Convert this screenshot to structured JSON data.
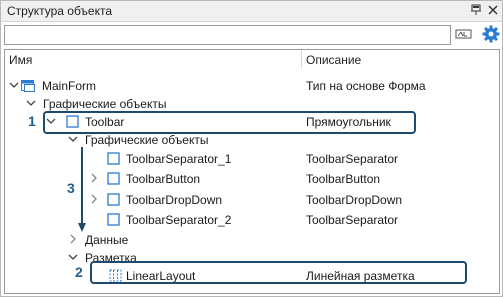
{
  "window": {
    "title": "Структура объекта"
  },
  "search": {
    "value": ""
  },
  "tree": {
    "columns": {
      "name": "Имя",
      "description": "Описание"
    },
    "rows": [
      {
        "label": "MainForm",
        "desc": "Тип на основе Форма"
      },
      {
        "label": "Графические объекты",
        "desc": ""
      },
      {
        "label": "Toolbar",
        "desc": "Прямоугольник"
      },
      {
        "label": "Графические объекты",
        "desc": ""
      },
      {
        "label": "ToolbarSeparator_1",
        "desc": "ToolbarSeparator"
      },
      {
        "label": "ToolbarButton",
        "desc": "ToolbarButton"
      },
      {
        "label": "ToolbarDropDown",
        "desc": "ToolbarDropDown"
      },
      {
        "label": "ToolbarSeparator_2",
        "desc": "ToolbarSeparator"
      },
      {
        "label": "Данные",
        "desc": ""
      },
      {
        "label": "Разметка",
        "desc": ""
      },
      {
        "label": "LinearLayout",
        "desc": "Линейная разметка"
      }
    ]
  },
  "annotations": {
    "n1": "1",
    "n2": "2",
    "n3": "3"
  },
  "colors": {
    "accent": "#1e4a6d",
    "badge": "#1f5f8b",
    "icon": "#2b7bd1"
  }
}
